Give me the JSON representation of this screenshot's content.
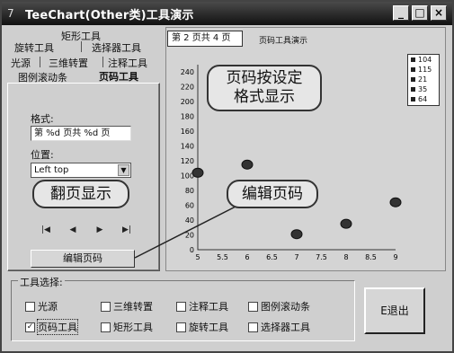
{
  "window": {
    "title": "TeeChart(Other类)工具演示",
    "buttons": [
      "_",
      "□",
      "×"
    ]
  },
  "tabs": {
    "row1": [
      "矩形工具"
    ],
    "row2": [
      "旋转工具",
      "选择器工具"
    ],
    "row3": [
      "光源",
      "三维转置",
      "注释工具"
    ],
    "row4": [
      "图例滚动条",
      "页码工具"
    ],
    "active": "页码工具"
  },
  "left_panel": {
    "format_label": "格式:",
    "format_value": "第 %d 页共 %d 页",
    "position_label": "位置:",
    "position_value": "Left top",
    "nav_icons": [
      "first-page-icon",
      "prev-page-icon",
      "next-page-icon",
      "last-page-icon"
    ],
    "nav_glyphs": [
      "|◀",
      "◀",
      "▶",
      "▶|"
    ],
    "edit_button": "编辑页码"
  },
  "callouts": {
    "flip": "翻页显示",
    "format": "页码按设定\n格式显示",
    "edit": "编辑页码"
  },
  "chart": {
    "page_badge": "第 2 页共 4 页",
    "title": "页码工具演示"
  },
  "chart_data": {
    "type": "scatter",
    "title": "页码工具演示",
    "x_tick_labels": [
      "5",
      "5.5",
      "6",
      "6.5",
      "7",
      "7.5",
      "8",
      "8.5",
      "9"
    ],
    "y_tick_labels": [
      "0",
      "20",
      "40",
      "60",
      "80",
      "100",
      "120",
      "140",
      "160",
      "180",
      "200",
      "220",
      "240"
    ],
    "x": [
      5,
      6,
      7,
      8,
      9
    ],
    "y": [
      104,
      115,
      21,
      35,
      64
    ],
    "ylim": [
      0,
      250
    ],
    "xlim": [
      5,
      9
    ],
    "legend": [
      "104",
      "115",
      "21",
      "35",
      "64"
    ],
    "legend_placement": "right",
    "grid": false
  },
  "tool_group": {
    "title": "工具选择:",
    "items": [
      {
        "label": "光源",
        "checked": false
      },
      {
        "label": "三维转置",
        "checked": false
      },
      {
        "label": "注释工具",
        "checked": false
      },
      {
        "label": "图例滚动条",
        "checked": false
      },
      {
        "label": "页码工具",
        "checked": true
      },
      {
        "label": "矩形工具",
        "checked": false
      },
      {
        "label": "旋转工具",
        "checked": false
      },
      {
        "label": "选择器工具",
        "checked": false
      }
    ],
    "exit_button": "E退出"
  }
}
